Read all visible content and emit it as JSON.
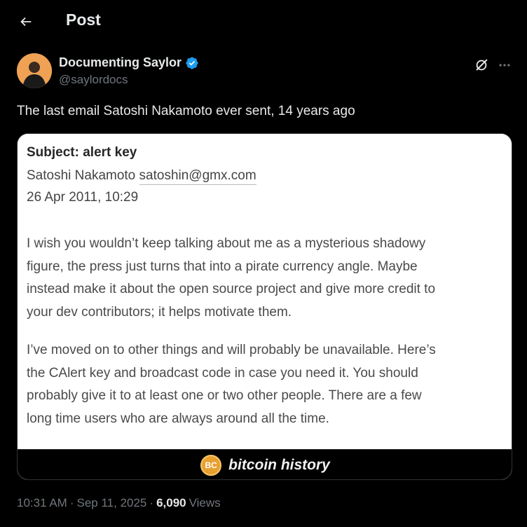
{
  "header": {
    "title": "Post"
  },
  "author": {
    "name": "Documenting Saylor",
    "handle": "@saylordocs",
    "verified": true
  },
  "post": {
    "text": "The last email Satoshi Nakamoto ever sent, 14 years ago"
  },
  "email": {
    "subject": "Subject: alert key",
    "from_name": "Satoshi Nakamoto",
    "from_email": "satoshin@gmx.com",
    "date": "26 Apr 2011, 10:29",
    "paragraph1_lines": [
      "I wish you wouldn’t keep talking about me as a mysterious shadowy",
      "figure, the press just turns that into a pirate currency angle. Maybe",
      "instead make it about the open source project and give more credit to",
      "your dev contributors; it helps motivate them."
    ],
    "paragraph2_lines": [
      "I’ve moved on to other things and will probably be unavailable. Here’s",
      "the CAlert key and broadcast code in case you need it. You should",
      "probably give it to at least one or two other people. There are a few",
      "long time users who are always around all the time."
    ]
  },
  "banner": {
    "logo_text": "BC",
    "text": "bitcoin history"
  },
  "meta": {
    "time": "10:31 AM",
    "separator": "·",
    "date": "Sep 11, 2025",
    "views_count": "6,090",
    "views_label": "Views"
  },
  "colors": {
    "background": "#000000",
    "text": "#e7e9ea",
    "muted": "#71767b",
    "verified": "#1d9bf0",
    "bitcoin": "#e8a030"
  },
  "icons": [
    "back-arrow-icon",
    "verified-badge-icon",
    "grok-icon",
    "more-icon",
    "bitcoin-logo-icon"
  ]
}
